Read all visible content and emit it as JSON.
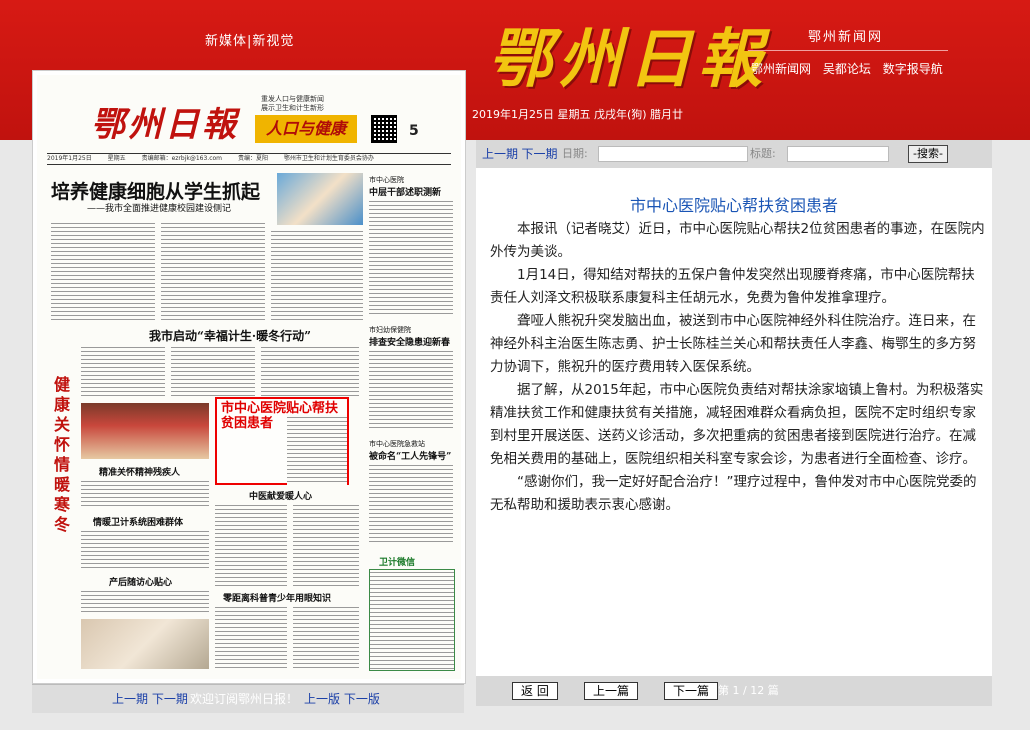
{
  "header": {
    "slogan": "新媒体|新视觉",
    "logo": "鄂州日報",
    "site_name": "鄂州新闻网",
    "links": [
      "鄂州新闻网",
      "吴都论坛",
      "数字报导航"
    ],
    "dateline": "2019年1月25日 星期五 戊戌年(狗) 腊月廿"
  },
  "paper": {
    "masthead": "鄂州日報",
    "section_badge": "人口与健康",
    "section_top": "重发人口与健康新闻\n展示卫生和计生新形",
    "page_number": "5",
    "info": [
      "2019年1月25日",
      "星期五",
      "责编邮箱：ezrbjk@163.com",
      "责编：夏阳",
      "鄂州市卫生和计划生育委员会协办"
    ],
    "headline_main": "培养健康细胞从学生抓起",
    "subhead_main": "——我市全面推进健康校园建设侧记",
    "col_head_1": "市中心医院",
    "col_title_1": "中层干部述职测新",
    "headline_2": "我市启动“幸福计生·暖冬行动”",
    "col_head_2": "市妇幼保健院",
    "col_title_2": "排查安全隐患迎新春",
    "col_head_3": "市中心医院急救站",
    "col_title_3": "被命名“工人先锋号”",
    "vertical_slogan": "健康关怀 情暖寒冬",
    "highlight_title": "市中心医院贴心帮扶贫困患者",
    "small_heads": [
      "精准关怀精神残疾人",
      "中医献爱暖人心",
      "情暖卫计系统困难群体",
      "产后随访心贴心",
      "零距离科普青少年用眼知识"
    ],
    "box_title": "卫计微信"
  },
  "paper_nav": {
    "prev_period": "上一期",
    "next_period": "下一期",
    "notice": "欢迎订阅鄂州日报！",
    "prev_page": "上一版",
    "next_page": "下一版"
  },
  "search": {
    "prev_period": "上一期",
    "next_period": "下一期",
    "date_label": "日期:",
    "title_label": "标题:",
    "button": "-搜索-"
  },
  "article": {
    "title": "市中心医院贴心帮扶贫困患者",
    "paragraphs": [
      "本报讯（记者晓艾）近日，市中心医院贴心帮扶2位贫困患者的事迹，在医院内外传为美谈。",
      "1月14日，得知结对帮扶的五保户鲁仲发突然出现腰脊疼痛，市中心医院帮扶责任人刘泽文积极联系康复科主任胡元水，免费为鲁仲发推拿理疗。",
      "聋哑人熊祝升突发脑出血，被送到市中心医院神经外科住院治疗。连日来，在神经外科主治医生陈志勇、护士长陈桂兰关心和帮扶责任人李鑫、梅鄂生的多方努力协调下，熊祝升的医疗费用转入医保系统。",
      "据了解，从2015年起，市中心医院负责结对帮扶涂家垴镇上鲁村。为积极落实精准扶贫工作和健康扶贫有关措施，减轻困难群众看病负担，医院不定时组织专家到村里开展送医、送药义诊活动，多次把重病的贫困患者接到医院进行治疗。在减免相关费用的基础上，医院组织相关科室专家会诊，为患者进行全面检查、诊疗。",
      "“感谢你们，我一定好好配合治疗！”理疗过程中，鲁仲发对市中心医院党委的无私帮助和援助表示衷心感谢。"
    ]
  },
  "bottom_nav": {
    "back": "返 回",
    "prev": "上一篇",
    "next": "下一篇",
    "pager": "第 1 / 12 篇"
  }
}
